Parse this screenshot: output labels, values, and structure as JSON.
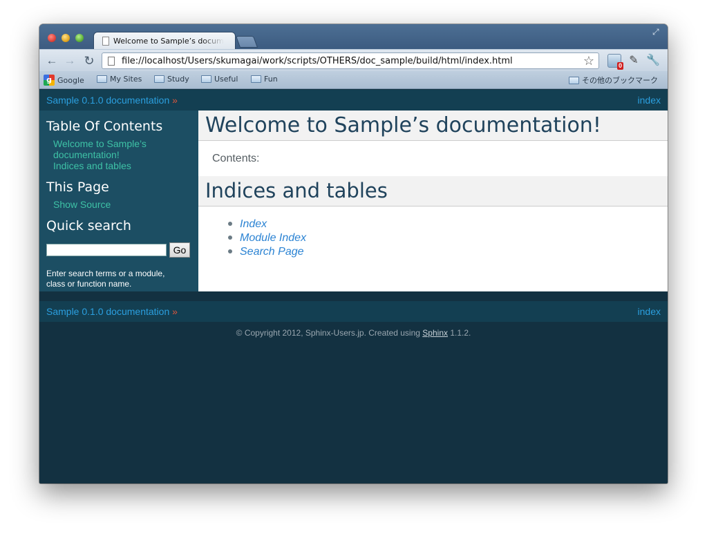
{
  "browser": {
    "tab_title": "Welcome to Sample’s documentation!",
    "url": "file://localhost/Users/skumagai/work/scripts/OTHERS/doc_sample/build/html/index.html",
    "extension_badge": "0",
    "bookmarks": [
      "Google",
      "My Sites",
      "Study",
      "Useful",
      "Fun"
    ],
    "other_bookmarks": "その他のブックマーク"
  },
  "relbar": {
    "doc_link": "Sample 0.1.0 documentation",
    "raquo": "»",
    "index_link": "index"
  },
  "sidebar": {
    "toc_title": "Table Of Contents",
    "toc_items": [
      "Welcome to Sample’s documentation!",
      "Indices and tables"
    ],
    "this_page_title": "This Page",
    "show_source": "Show Source",
    "quick_search_title": "Quick search",
    "go_label": "Go",
    "search_hint": "Enter search terms or a module, class or function name."
  },
  "main": {
    "h1": "Welcome to Sample’s documentation!",
    "contents_label": "Contents:",
    "h2": "Indices and tables",
    "links": [
      "Index",
      "Module Index",
      "Search Page"
    ]
  },
  "footer": {
    "text_before": "© Copyright 2012, Sphinx-Users.jp. Created using ",
    "sphinx_link": "Sphinx",
    "text_after": " 1.1.2."
  },
  "colors": {
    "page_bg": "#133141",
    "sidebar_bg": "#1c4e63",
    "relbar_bg": "#133f52",
    "link_blue": "#2b9fdf",
    "sidebar_link": "#3ec2a6",
    "heading": "#20435c"
  }
}
